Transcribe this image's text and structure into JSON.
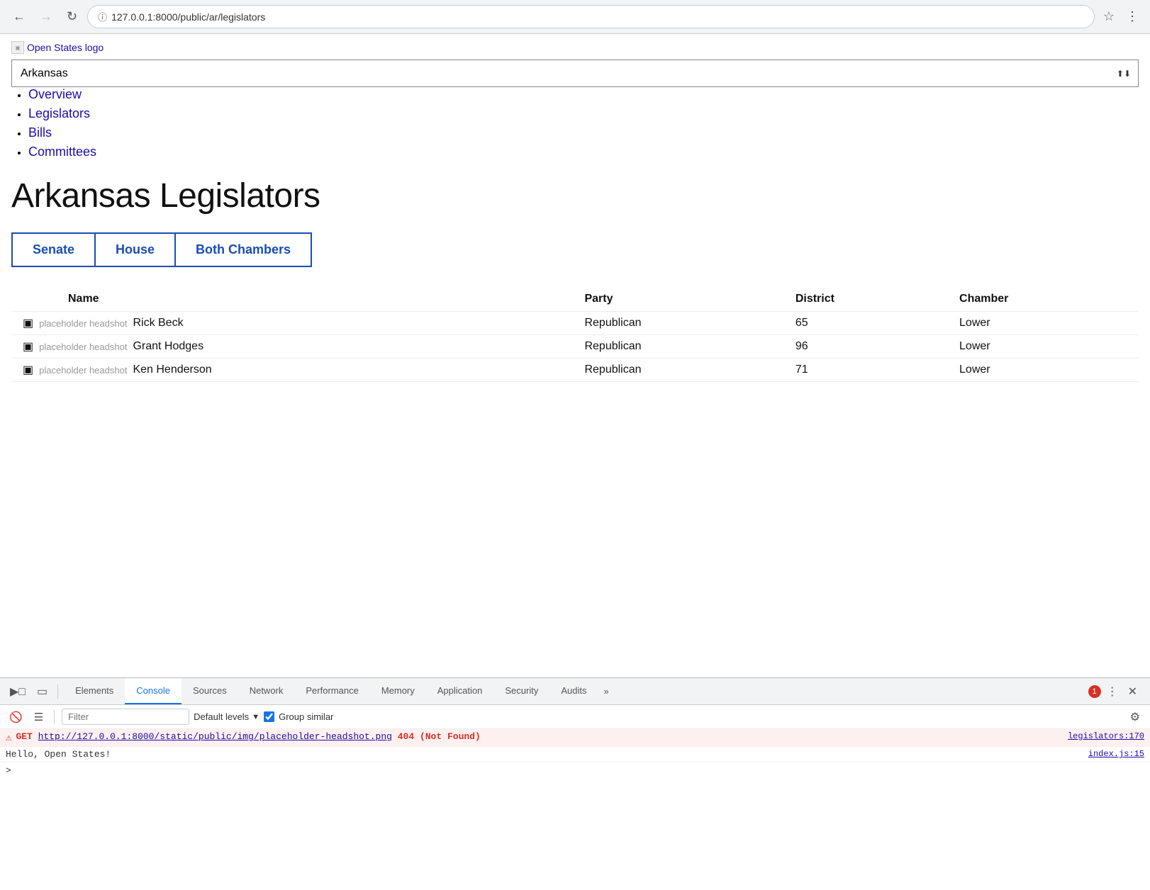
{
  "browser": {
    "url": "127.0.0.1:8000/public/ar/legislators",
    "url_host": "127.0.0.1",
    "url_path": ":8000/public/ar/legislators"
  },
  "logo": {
    "alt": "Open States logo",
    "text": "Open States logo"
  },
  "state_select": {
    "current": "Arkansas",
    "placeholder": "Arkansas"
  },
  "nav": {
    "items": [
      {
        "label": "Overview",
        "href": "#"
      },
      {
        "label": "Legislators",
        "href": "#"
      },
      {
        "label": "Bills",
        "href": "#"
      },
      {
        "label": "Committees",
        "href": "#"
      }
    ]
  },
  "page_title": "Arkansas Legislators",
  "chamber_tabs": [
    {
      "label": "Senate",
      "id": "senate"
    },
    {
      "label": "House",
      "id": "house"
    },
    {
      "label": "Both Chambers",
      "id": "both"
    }
  ],
  "table": {
    "columns": [
      "Name",
      "Party",
      "District",
      "Chamber"
    ],
    "rows": [
      {
        "name": "Rick Beck",
        "party": "Republican",
        "district": "65",
        "chamber": "Lower"
      },
      {
        "name": "Grant Hodges",
        "party": "Republican",
        "district": "96",
        "chamber": "Lower"
      },
      {
        "name": "Ken Henderson",
        "party": "Republican",
        "district": "71",
        "chamber": "Lower"
      }
    ]
  },
  "devtools": {
    "tabs": [
      "Elements",
      "Console",
      "Sources",
      "Network",
      "Performance",
      "Memory",
      "Application",
      "Security",
      "Audits"
    ],
    "active_tab": "Console",
    "more_label": "»",
    "error_count": "1",
    "console": {
      "filter_placeholder": "Filter",
      "level_label": "Default levels",
      "group_similar_label": "Group similar",
      "output": [
        {
          "type": "error",
          "get": "GET",
          "url": "http://127.0.0.1:8000/static/public/img/placeholder-headshot.png",
          "status": "404 (Not Found)",
          "link": "legislators:170"
        },
        {
          "type": "info",
          "text": "Hello, Open States!",
          "link": "index.js:15"
        }
      ]
    }
  }
}
